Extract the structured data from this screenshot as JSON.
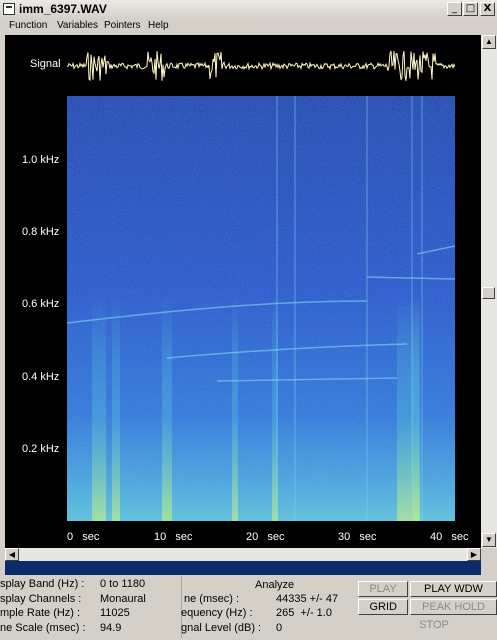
{
  "window": {
    "title": "imm_6397.WAV"
  },
  "titlebar_buttons": {
    "minimize": "_",
    "maximize": "□",
    "close": "X"
  },
  "menu": [
    "Function",
    "Variables",
    "Pointers",
    "Help"
  ],
  "plot": {
    "signal_label": "Signal",
    "y_labels": [
      "1.0 kHz",
      "0.8 kHz",
      "0.6 kHz",
      "0.4 kHz",
      "0.2 kHz"
    ],
    "x_labels": [
      "0   sec",
      "10   sec",
      "20   sec",
      "30   sec",
      "40   sec"
    ]
  },
  "info": {
    "display_band_label": "splay Band (Hz) :",
    "display_band_value": "0 to 1180",
    "display_channels_label": "splay Channels :",
    "display_channels_value": "Monaural",
    "sample_rate_label": "mple Rate (Hz) :",
    "sample_rate_value": "11025",
    "time_scale_label": "ne Scale (msec) :",
    "time_scale_value": "94.9",
    "analyze_title": "Analyze",
    "time_label": "ne (msec) :",
    "time_value": "44335 +/- 47",
    "frequency_label": "equency (Hz) :",
    "frequency_value": "265  +/- 1.0",
    "signal_level_label": "gnal Level (dB) :",
    "signal_level_value": "0"
  },
  "buttons": {
    "play": "PLAY",
    "play_wdw": "PLAY WDW",
    "grid": "GRID",
    "peak_hold": "PEAK HOLD",
    "stop": "STOP"
  },
  "colors": {
    "background": "#000000",
    "spectrogram_base": "#1b45b8",
    "spectrogram_high": "#6fe0d8",
    "waveform": "#fff8c8",
    "panel": "#d4d0c8",
    "status_bar": "#0a2a6a"
  },
  "icons": {
    "window_icon": "app-icon"
  }
}
